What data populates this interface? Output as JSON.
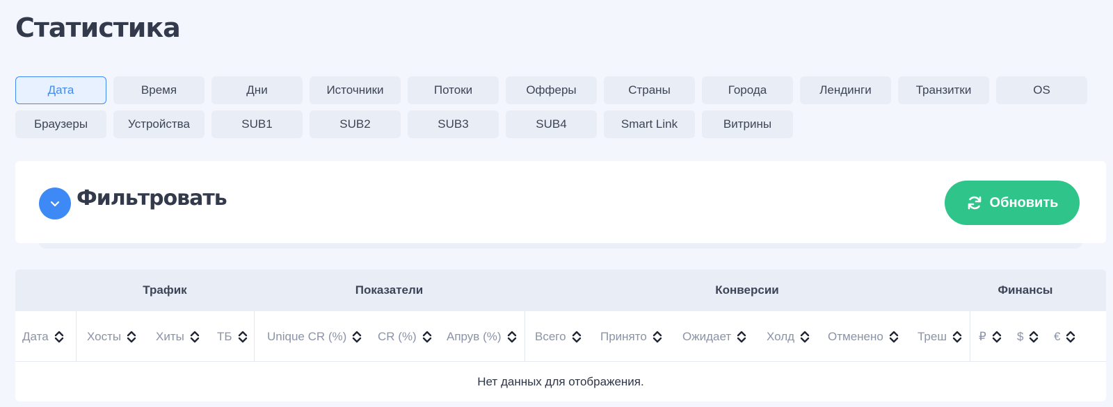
{
  "page": {
    "title": "Статистика"
  },
  "tabs": {
    "row1": [
      "Дата",
      "Время",
      "Дни",
      "Источники",
      "Потоки",
      "Офферы",
      "Страны",
      "Города",
      "Лендинги",
      "Транзитки",
      "OS"
    ],
    "row2": [
      "Браузеры",
      "Устройства",
      "SUB1",
      "SUB2",
      "SUB3",
      "SUB4",
      "Smart Link",
      "Витрины"
    ],
    "active": "Дата"
  },
  "filter": {
    "title": "Фильтровать",
    "refresh_label": "Обновить",
    "toggle_icon": "chevron-down-icon",
    "refresh_icon": "refresh-icon"
  },
  "table": {
    "groups": [
      "Трафик",
      "Показатели",
      "Конверсии",
      "Финансы"
    ],
    "columns": [
      "Дата",
      "Хосты",
      "Хиты",
      "ТБ",
      "Unique CR (%)",
      "CR (%)",
      "Апрув (%)",
      "Всего",
      "Принято",
      "Ожидает",
      "Холд",
      "Отменено",
      "Треш",
      "₽",
      "$",
      "€"
    ],
    "empty_message": "Нет данных для отображения."
  },
  "colors": {
    "accent": "#3d8af7",
    "success": "#2ec48a",
    "background": "#f3f6fd",
    "header_bg": "#e9edf6"
  }
}
